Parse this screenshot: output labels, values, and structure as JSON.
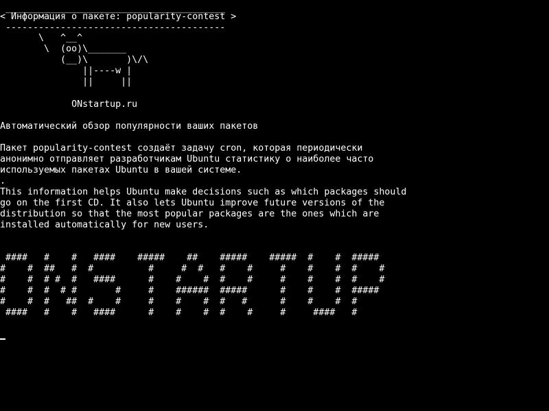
{
  "terminal": {
    "background_color": "#000000",
    "text_color": "#ffffff",
    "bubble_top_border": " ________________________________________",
    "bubble_text": "< Информация о пакете: popularity-contest >",
    "bubble_bottom_border": " ----------------------------------------",
    "cow": [
      "       \\   ^__^",
      "        \\  (oo)\\_______",
      "           (__)\\       )\\/\\",
      "               ||----w |",
      "               ||     ||"
    ],
    "site": "             ONstartup.ru",
    "heading": "Автоматический обзор популярности ваших пакетов",
    "description_ru": [
      "Пакет popularity-contest создаёт задачу cron, которая периодически",
      "анонимно отправляет разработчикам Ubuntu статистику о наиболее часто",
      "используемых пакетах Ubuntu в вашей системе."
    ],
    "dot": ".",
    "description_en": [
      "This information helps Ubuntu make decisions such as which packages should",
      "go on the first CD. It also lets Ubuntu improve future versions of the",
      "distribution so that the most popular packages are the ones which are",
      "installed automatically for new users."
    ],
    "banner": [
      " ####   #    #   ####    #####    ##    #####    #####  #    #  #####",
      "#    #  ##   #  #          #     #  #   #    #     #    #    #  #    #",
      "#    #  # #  #   ####      #    #    #  #    #     #    #    #  #    #",
      "#    #  #  # #       #     #    ######  #####      #    #    #  #####",
      "#    #  #   ##  #    #     #    #    #  #   #      #    #    #  #",
      " ####   #    #   ####      #    #    #  #    #     #     ####   #"
    ]
  }
}
